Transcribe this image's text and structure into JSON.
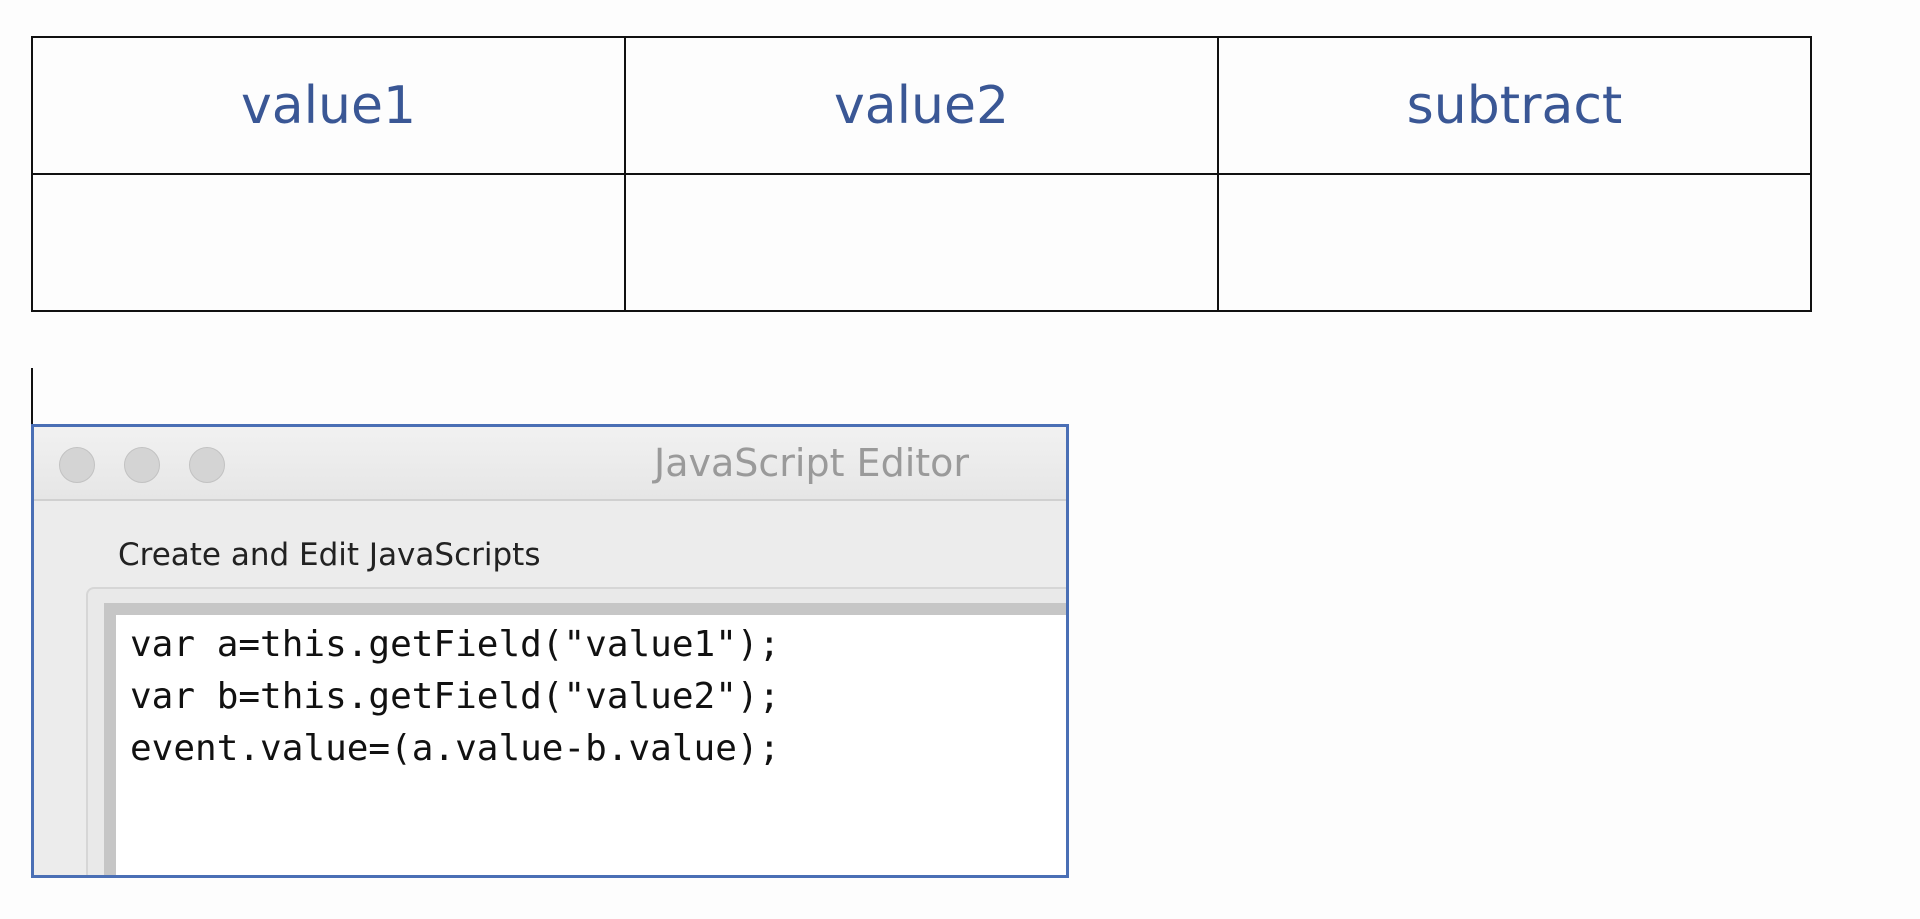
{
  "table": {
    "headers": [
      "value1",
      "value2",
      "subtract"
    ],
    "values": [
      "",
      "",
      ""
    ]
  },
  "editor": {
    "window_title": "JavaScript Editor",
    "section_label": "Create and Edit JavaScripts",
    "code_lines": [
      "var a=this.getField(\"value1\");",
      "var b=this.getField(\"value2\");",
      "event.value=(a.value-b.value);"
    ]
  },
  "colors": {
    "header_text": "#3a5795",
    "window_border": "#4a6fb5"
  }
}
